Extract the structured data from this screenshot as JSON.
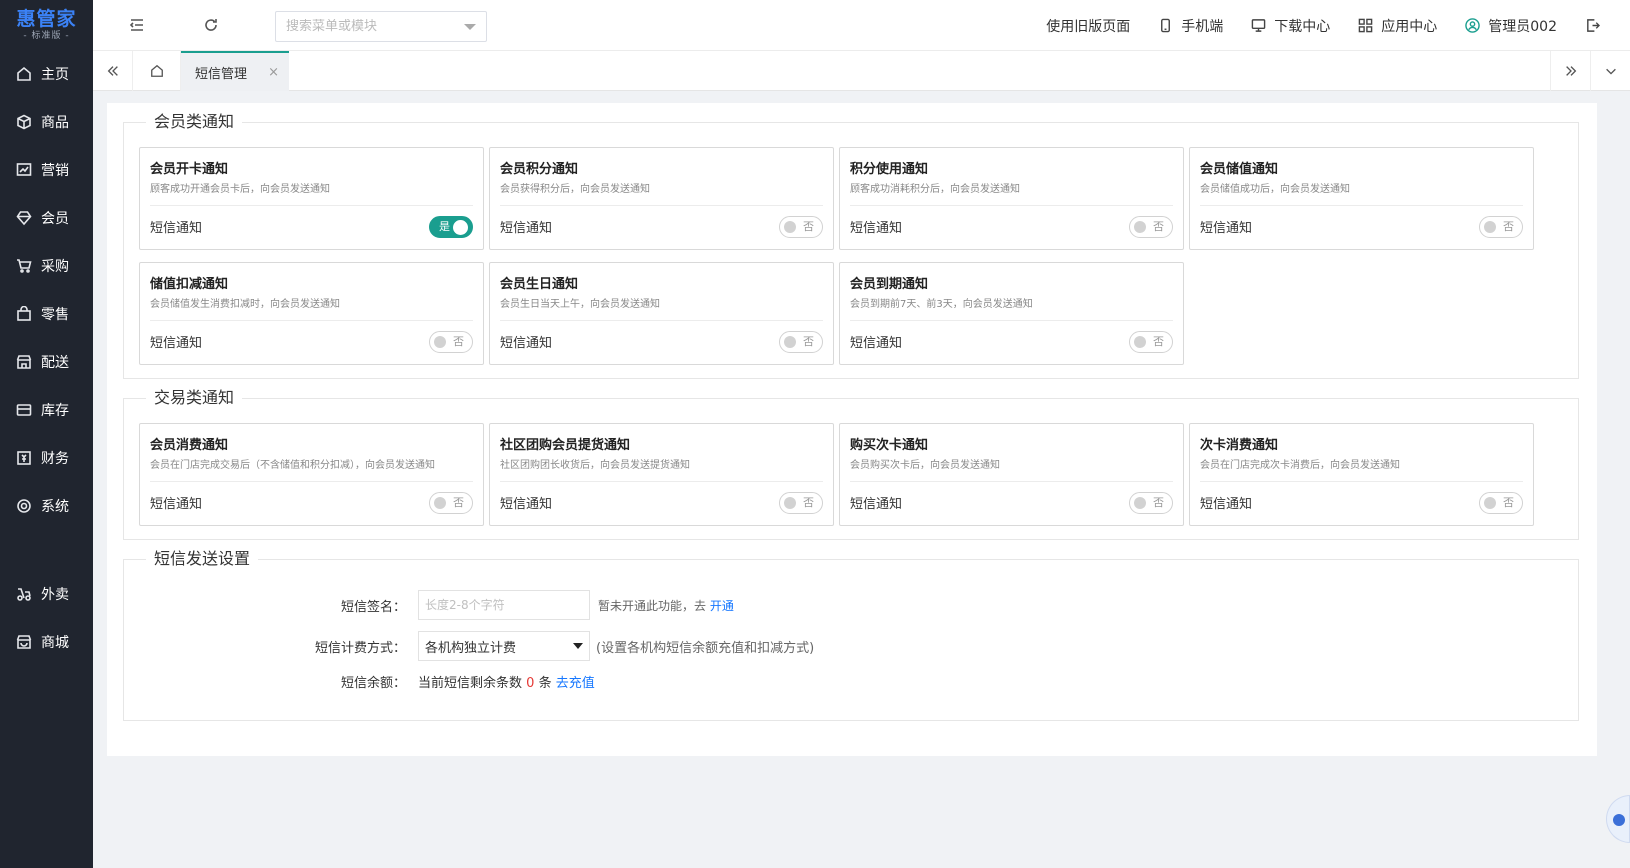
{
  "sidebar": {
    "logo": {
      "main": "惠管家",
      "sub": "- 标准版 -"
    },
    "items": [
      {
        "label": "主页",
        "icon": "home-icon"
      },
      {
        "label": "商品",
        "icon": "box-icon"
      },
      {
        "label": "营销",
        "icon": "chart-icon"
      },
      {
        "label": "会员",
        "icon": "diamond-icon"
      },
      {
        "label": "采购",
        "icon": "cart-icon"
      },
      {
        "label": "零售",
        "icon": "bag-icon"
      },
      {
        "label": "配送",
        "icon": "store-icon"
      },
      {
        "label": "库存",
        "icon": "inventory-icon"
      },
      {
        "label": "财务",
        "icon": "finance-icon"
      },
      {
        "label": "系统",
        "icon": "system-icon"
      }
    ],
    "extra_items": [
      {
        "label": "外卖",
        "icon": "delivery-icon"
      },
      {
        "label": "商城",
        "icon": "mall-icon"
      }
    ]
  },
  "topbar": {
    "search_placeholder": "搜索菜单或模块",
    "old_page": "使用旧版页面",
    "mobile": "手机端",
    "download": "下载中心",
    "apps": "应用中心",
    "user": "管理员002"
  },
  "tabs": {
    "active": "短信管理",
    "close": "×"
  },
  "sections": {
    "member": {
      "title": "会员类通知",
      "cards": [
        {
          "title": "会员开卡通知",
          "desc": "顾客成功开通会员卡后，向会员发送通知",
          "label": "短信通知",
          "on": true,
          "state": "是"
        },
        {
          "title": "会员积分通知",
          "desc": "会员获得积分后，向会员发送通知",
          "label": "短信通知",
          "on": false,
          "state": "否"
        },
        {
          "title": "积分使用通知",
          "desc": "顾客成功消耗积分后，向会员发送通知",
          "label": "短信通知",
          "on": false,
          "state": "否"
        },
        {
          "title": "会员储值通知",
          "desc": "会员储值成功后，向会员发送通知",
          "label": "短信通知",
          "on": false,
          "state": "否"
        },
        {
          "title": "储值扣减通知",
          "desc": "会员储值发生消费扣减时，向会员发送通知",
          "label": "短信通知",
          "on": false,
          "state": "否"
        },
        {
          "title": "会员生日通知",
          "desc": "会员生日当天上午，向会员发送通知",
          "label": "短信通知",
          "on": false,
          "state": "否"
        },
        {
          "title": "会员到期通知",
          "desc": "会员到期前7天、前3天，向会员发送通知",
          "label": "短信通知",
          "on": false,
          "state": "否"
        }
      ]
    },
    "trade": {
      "title": "交易类通知",
      "cards": [
        {
          "title": "会员消费通知",
          "desc": "会员在门店完成交易后（不含储值和积分扣减），向会员发送通知",
          "label": "短信通知",
          "on": false,
          "state": "否"
        },
        {
          "title": "社区团购会员提货通知",
          "desc": "社区团购团长收货后，向会员发送提货通知",
          "label": "短信通知",
          "on": false,
          "state": "否"
        },
        {
          "title": "购买次卡通知",
          "desc": "会员购买次卡后，向会员发送通知",
          "label": "短信通知",
          "on": false,
          "state": "否"
        },
        {
          "title": "次卡消费通知",
          "desc": "会员在门店完成次卡消费后，向会员发送通知",
          "label": "短信通知",
          "on": false,
          "state": "否"
        }
      ]
    },
    "settings": {
      "title": "短信发送设置",
      "signature_label": "短信签名：",
      "signature_placeholder": "长度2-8个字符",
      "signature_hint": "暂未开通此功能，去",
      "signature_link": "开通",
      "billing_label": "短信计费方式：",
      "billing_value": "各机构独立计费",
      "billing_hint": "(设置各机构短信余额充值和扣减方式)",
      "balance_label": "短信余额：",
      "balance_prefix": "当前短信剩余条数",
      "balance_count": "0",
      "balance_unit": "条",
      "balance_link": "去充值"
    }
  },
  "colors": {
    "accent": "#1a9e8f",
    "sidebar": "#20252f",
    "link": "#1677ff"
  }
}
